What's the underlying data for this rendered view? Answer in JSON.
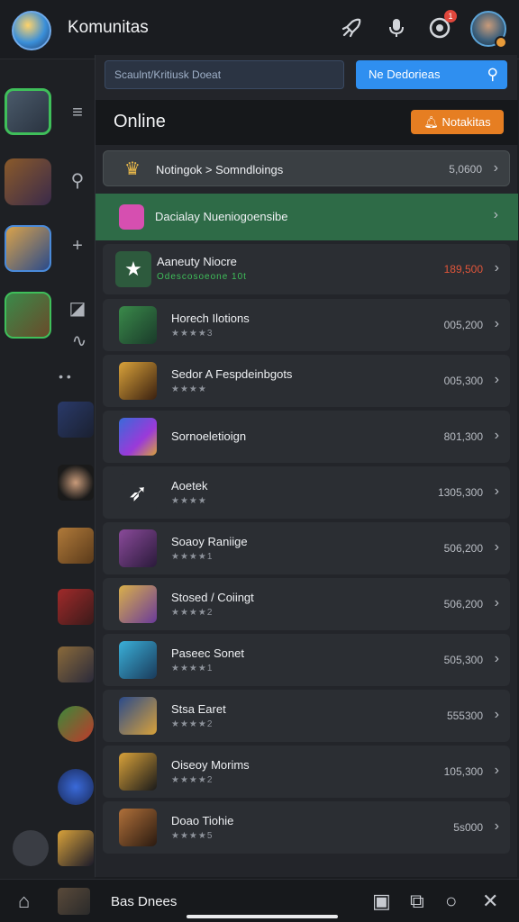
{
  "header": {
    "title": "Komunitas",
    "icons": [
      "logo-avatar",
      "rocket-icon",
      "mic-icon",
      "shield-icon",
      "user-avatar"
    ],
    "badge_count": "1"
  },
  "search": {
    "placeholder": "Scaulnt/Kritiusk Doeat",
    "button_label": "Ne Dedorieas"
  },
  "panel": {
    "heading": "Online",
    "notif_label": "Notakitas"
  },
  "rows": [
    {
      "name": "Notingok > Somndloings",
      "value": "5,0600",
      "icon": "crown-icon"
    },
    {
      "name": "Dacialay Nueniogoensibe",
      "value": "",
      "icon": "pink-app-icon"
    },
    {
      "name": "Aaneuty Niocre",
      "sub": "Odescosoeone 10t",
      "value": "189,500",
      "icon": "star-icon"
    },
    {
      "name": "Horech Ilotions",
      "stars": "★★★★3",
      "value": "005,200",
      "icon": "green-hero-icon"
    },
    {
      "name": "Sedor A Fespdeinbgots",
      "stars": "★★★★",
      "value": "005,300",
      "icon": "dragon-icon"
    },
    {
      "name": "Sornoeletioign",
      "value": "801,300",
      "icon": "fio-app-icon"
    },
    {
      "name": "Aoetek",
      "stars": "★★★★",
      "value": "1305,300",
      "icon": "arrow-app-icon"
    },
    {
      "name": "Soaoy Raniige",
      "stars": "★★★★1",
      "value": "506,200",
      "icon": "mage-icon"
    },
    {
      "name": "Stosed / Coiingt",
      "stars": "★★★★2",
      "value": "506,200",
      "icon": "wizard-icon"
    },
    {
      "name": "Paseec Sonet",
      "stars": "★★★★1",
      "value": "505,300",
      "icon": "robot-icon"
    },
    {
      "name": "Stsa Earet",
      "stars": "★★★★2",
      "value": "555300",
      "icon": "knight-icon"
    },
    {
      "name": "Oiseoy Morims",
      "stars": "★★★★2",
      "value": "105,300",
      "icon": "beast-icon"
    },
    {
      "name": "Doao Tiohie",
      "stars": "★★★★5",
      "value": "5s000",
      "icon": "warrior-icon"
    }
  ],
  "bottom": {
    "label": "Bas Dnees"
  },
  "colors": {
    "accent": "#2f8ff0",
    "notif": "#e67e22",
    "highlight_green": "#2e6b47",
    "value_red": "#e0553a"
  }
}
